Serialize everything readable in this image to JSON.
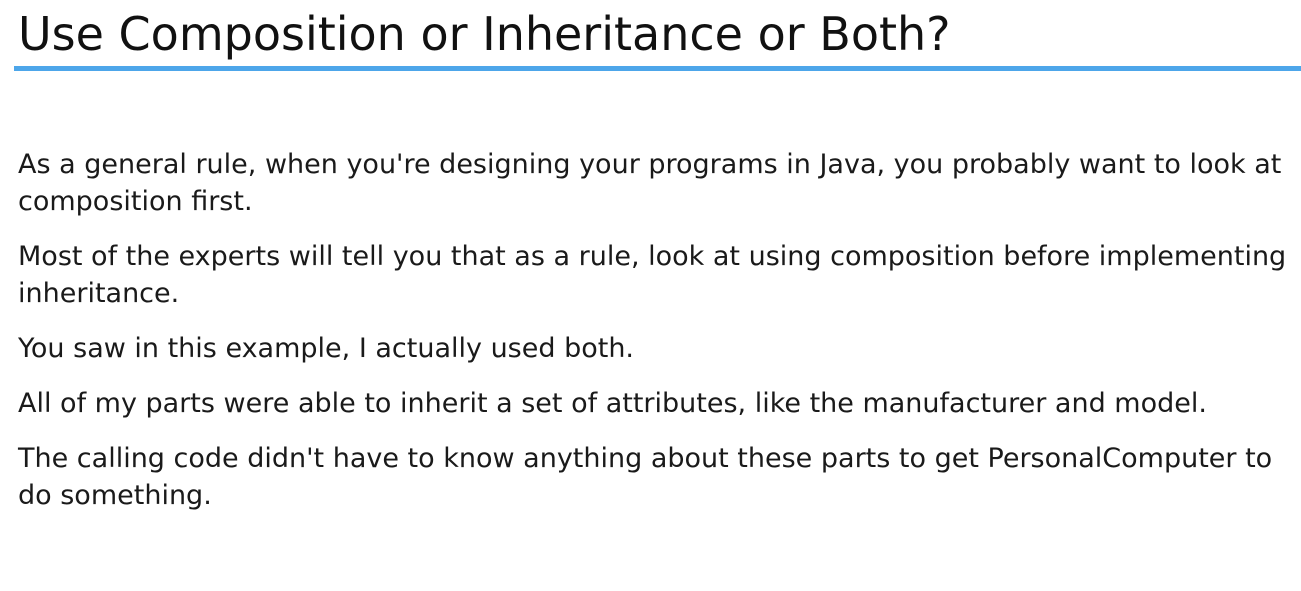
{
  "slide": {
    "title": "Use Composition or Inheritance or Both?",
    "accent_color": "#4da6ea",
    "paragraphs": [
      "As a general rule, when you're designing your programs in Java, you probably want to look at composition first.",
      "Most of the experts will tell you that as a rule, look at using composition before implementing inheritance.",
      "You saw in this example, I actually used both.",
      "All of my parts were able to inherit a set of attributes, like the manufacturer and model.",
      "The calling code didn't have to know anything about these parts to get PersonalComputer to do something."
    ]
  }
}
